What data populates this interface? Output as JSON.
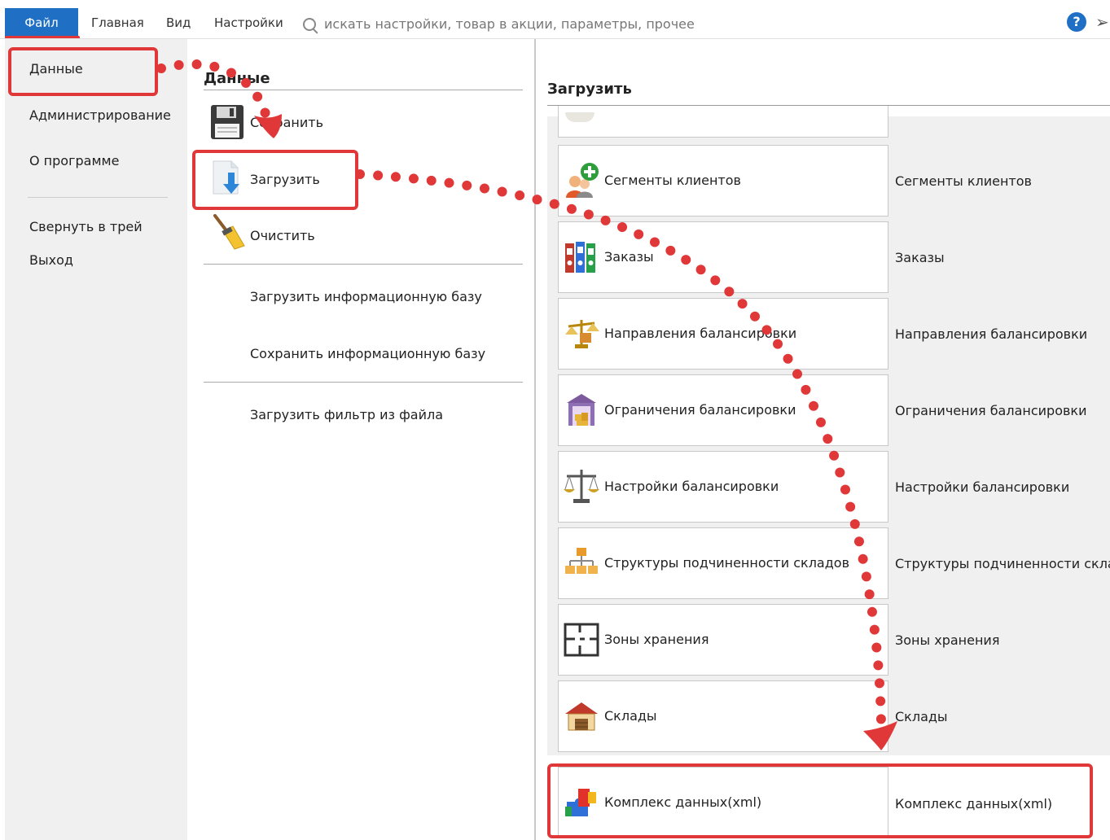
{
  "menu_tabs": {
    "file": "Файл",
    "home": "Главная",
    "view": "Вид",
    "settings": "Настройки"
  },
  "search": {
    "placeholder": "искать настройки, товар в акции, параметры, прочее",
    "icon": "search-icon"
  },
  "header_icons": {
    "help": "?",
    "send": "send-icon"
  },
  "left_menu": {
    "data": "Данные",
    "admin": "Администрирование",
    "about": "О программе",
    "tray": "Свернуть в трей",
    "exit": "Выход"
  },
  "middle": {
    "title": "Данные",
    "save": "Сохранить",
    "load": "Загрузить",
    "clear": "Очистить",
    "load_db": "Загрузить информационную базу",
    "save_db": "Сохранить информационную базу",
    "load_filter": "Загрузить фильтр из файла"
  },
  "right": {
    "title": "Загрузить",
    "items": [
      {
        "label": "Сегменты клиентов",
        "desc": "Сегменты клиентов",
        "icon": "customer-segments-icon"
      },
      {
        "label": "Заказы",
        "desc": "Заказы",
        "icon": "orders-binders-icon"
      },
      {
        "label": "Направления балансировки",
        "desc": "Направления балансировки",
        "icon": "balance-directions-icon"
      },
      {
        "label": "Ограничения балансировки",
        "desc": "Ограничения балансировки",
        "icon": "balance-limits-icon"
      },
      {
        "label": "Настройки балансировки",
        "desc": "Настройки балансировки",
        "icon": "scales-icon"
      },
      {
        "label": "Структуры подчиненности складов",
        "desc": "Структуры подчиненности склад",
        "icon": "hierarchy-icon"
      },
      {
        "label": "Зоны хранения",
        "desc": "Зоны хранения",
        "icon": "storage-zones-icon"
      },
      {
        "label": "Склады",
        "desc": "Склады",
        "icon": "warehouse-icon"
      },
      {
        "label": "Комплекс данных(xml)",
        "desc": "Комплекс данных(xml)",
        "icon": "puzzle-icon"
      }
    ]
  },
  "colors": {
    "accent": "#1f6fc5",
    "highlight": "#e03838",
    "panel": "#f0f0f0"
  }
}
